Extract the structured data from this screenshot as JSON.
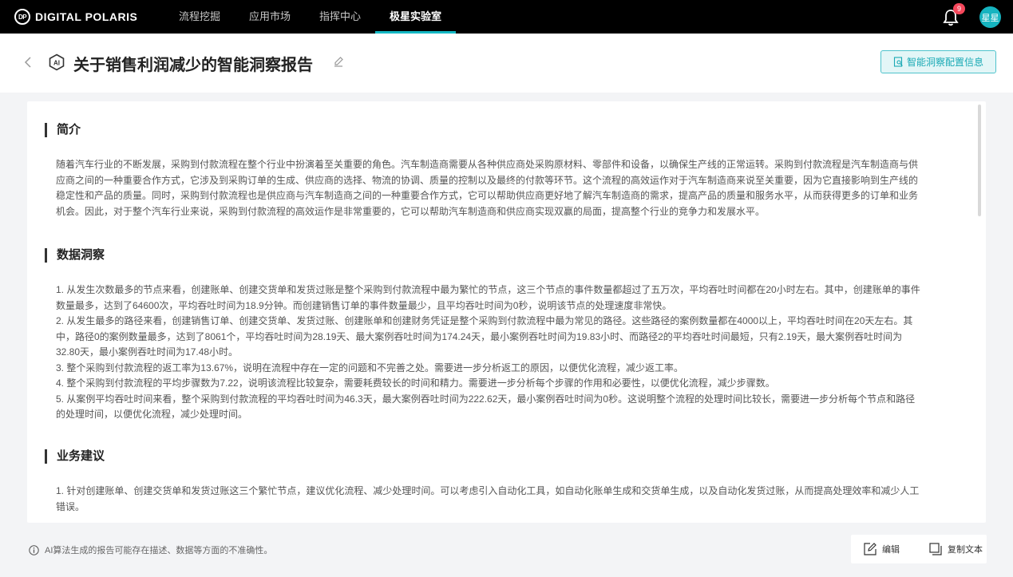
{
  "brand": {
    "mark": "DP",
    "name": "DIGITAL POLARIS"
  },
  "nav": {
    "items": [
      {
        "label": "流程挖掘"
      },
      {
        "label": "应用市场"
      },
      {
        "label": "指挥中心"
      },
      {
        "label": "极星实验室"
      }
    ],
    "active_index": 3
  },
  "notifications": {
    "count": "9",
    "icon": "bell-icon"
  },
  "user": {
    "avatar_text": "星星"
  },
  "report": {
    "ai_badge": "AI",
    "title": "关于销售利润减少的智能洞察报告",
    "config_button": "智能洞察配置信息"
  },
  "sections": [
    {
      "title": "简介",
      "lines": [
        "随着汽车行业的不断发展，采购到付款流程在整个行业中扮演着至关重要的角色。汽车制造商需要从各种供应商处采购原材料、零部件和设备，以确保生产线的正常运转。采购到付款流程是汽车制造商与供",
        "应商之间的一种重要合作方式，它涉及到采购订单的生成、供应商的选择、物流的协调、质量的控制以及最终的付款等环节。这个流程的高效运作对于汽车制造商来说至关重要，因为它直接影响到生产线的",
        "稳定性和产品的质量。同时，采购到付款流程也是供应商与汽车制造商之间的一种重要合作方式，它可以帮助供应商更好地了解汽车制造商的需求，提高产品的质量和服务水平，从而获得更多的订单和业务",
        "机会。因此，对于整个汽车行业来说，采购到付款流程的高效运作是非常重要的，它可以帮助汽车制造商和供应商实现双赢的局面，提高整个行业的竞争力和发展水平。"
      ]
    },
    {
      "title": "数据洞察",
      "lines": [
        "1. 从发生次数最多的节点来看，创建账单、创建交货单和发货过账是整个采购到付款流程中最为繁忙的节点，这三个节点的事件数量都超过了五万次，平均吞吐时间都在20小时左右。其中，创建账单的事件",
        "数量最多，达到了64600次，平均吞吐时间为18.9分钟。而创建销售订单的事件数量最少，且平均吞吐时间为0秒，说明该节点的处理速度非常快。",
        "2. 从发生最多的路径来看，创建销售订单、创建交货单、发货过账、创建账单和创建财务凭证是整个采购到付款流程中最为常见的路径。这些路径的案例数量都在4000以上，平均吞吐时间在20天左右。其",
        "中，路径0的案例数量最多，达到了8061个，平均吞吐时间为28.19天、最大案例吞吐时间为174.24天，最小案例吞吐时间为19.83小时、而路径2的平均吞吐时间最短，只有2.19天，最大案例吞吐时间为",
        "32.80天，最小案例吞吐时间为17.48小时。",
        "3. 整个采购到付款流程的返工率为13.67%，说明在流程中存在一定的问题和不完善之处。需要进一步分析返工的原因，以便优化流程，减少返工率。",
        "4. 整个采购到付款流程的平均步骤数为7.22，说明该流程比较复杂，需要耗费较长的时间和精力。需要进一步分析每个步骤的作用和必要性，以便优化流程，减少步骤数。",
        "5. 从案例平均吞吐时间来看，整个采购到付款流程的平均吞吐时间为46.3天，最大案例吞吐时间为222.62天，最小案例吞吐时间为0秒。这说明整个流程的处理时间比较长，需要进一步分析每个节点和路径",
        "的处理时间，以便优化流程，减少处理时间。"
      ]
    },
    {
      "title": "业务建议",
      "lines": [
        "1. 针对创建账单、创建交货单和发货过账这三个繁忙节点，建议优化流程、减少处理时间。可以考虑引入自动化工具，如自动化账单生成和交货单生成，以及自动化发货过账，从而提高处理效率和减少人工",
        "错误。"
      ]
    }
  ],
  "footer": {
    "disclaimer": "AI算法生成的报告可能存在描述、数据等方面的不准确性。",
    "edit_label": "编辑",
    "copy_label": "复制文本"
  }
}
